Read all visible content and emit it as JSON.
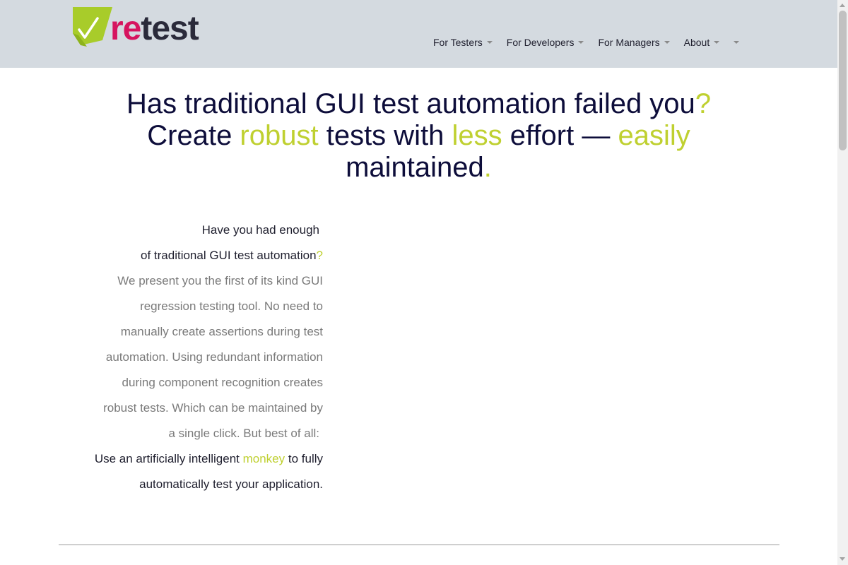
{
  "header": {
    "logo": {
      "part1": "re",
      "part2": "test"
    },
    "nav": [
      {
        "label": "For Testers"
      },
      {
        "label": "For Developers"
      },
      {
        "label": "For Managers"
      },
      {
        "label": "About"
      }
    ]
  },
  "hero": {
    "line1_a": "Has traditional GUI test automation failed you",
    "line1_q": "?",
    "line2_a": "Create ",
    "line2_b": "robust",
    "line2_c": " tests with ",
    "line2_d": "less",
    "line2_e": " effort — ",
    "line2_f": "easily",
    "line3_a": "maintained",
    "line3_b": "."
  },
  "intro": {
    "q1": "Have you had enough ",
    "q2": "of traditional GUI test automation",
    "q2_mark": "?",
    "p1": "We present you the first of its kind GUI",
    "p2": "regression testing tool. No need to",
    "p3": "manually create assertions during test",
    "p4": "automation. Using redundant information",
    "p5": "during component recognition creates",
    "p6": "robust tests. Which can be maintained by",
    "p7": "a single click. But best of all: ",
    "m1_a": "Use an artificially intelligent ",
    "m1_b": "monkey",
    "m1_c": " to fully",
    "m2": "automatically test your application."
  },
  "colors": {
    "header_bg": "#d4dae0",
    "accent": "#bfd030",
    "brand_re": "#d6145f",
    "heading": "#0d0d3a"
  }
}
